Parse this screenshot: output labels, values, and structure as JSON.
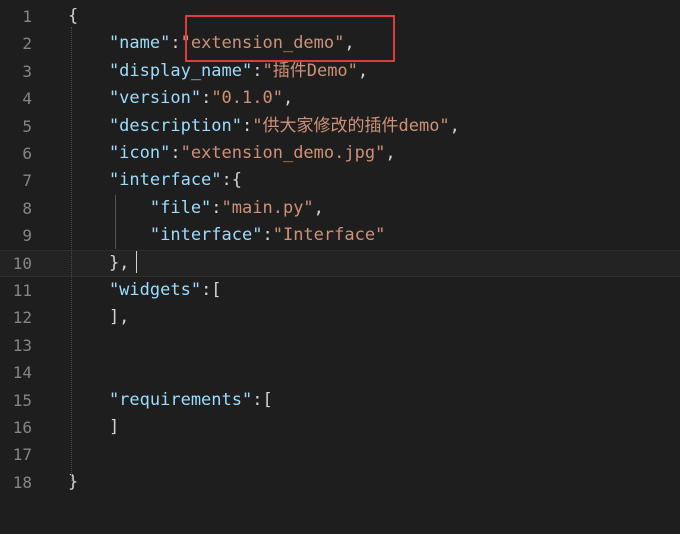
{
  "editor": {
    "line_numbers": [
      "1",
      "2",
      "3",
      "4",
      "5",
      "6",
      "7",
      "8",
      "9",
      "10",
      "11",
      "12",
      "13",
      "14",
      "15",
      "16",
      "17",
      "18"
    ],
    "lines": [
      [
        {
          "t": "{",
          "c": "punc"
        }
      ],
      [
        {
          "t": "    \"name\"",
          "c": "key"
        },
        {
          "t": ":",
          "c": "punc"
        },
        {
          "t": "\"extension_demo\"",
          "c": "str"
        },
        {
          "t": ",",
          "c": "punc"
        }
      ],
      [
        {
          "t": "    \"display_name\"",
          "c": "key"
        },
        {
          "t": ":",
          "c": "punc"
        },
        {
          "t": "\"插件Demo\"",
          "c": "str"
        },
        {
          "t": ",",
          "c": "punc"
        }
      ],
      [
        {
          "t": "    \"version\"",
          "c": "key"
        },
        {
          "t": ":",
          "c": "punc"
        },
        {
          "t": "\"0.1.0\"",
          "c": "str"
        },
        {
          "t": ",",
          "c": "punc"
        }
      ],
      [
        {
          "t": "    \"description\"",
          "c": "key"
        },
        {
          "t": ":",
          "c": "punc"
        },
        {
          "t": "\"供大家修改的插件demo\"",
          "c": "str"
        },
        {
          "t": ",",
          "c": "punc"
        }
      ],
      [
        {
          "t": "    \"icon\"",
          "c": "key"
        },
        {
          "t": ":",
          "c": "punc"
        },
        {
          "t": "\"extension_demo.jpg\"",
          "c": "str"
        },
        {
          "t": ",",
          "c": "punc"
        }
      ],
      [
        {
          "t": "    \"interface\"",
          "c": "key"
        },
        {
          "t": ":{",
          "c": "punc"
        }
      ],
      [
        {
          "t": "        \"file\"",
          "c": "key"
        },
        {
          "t": ":",
          "c": "punc"
        },
        {
          "t": "\"main.py\"",
          "c": "str"
        },
        {
          "t": ",",
          "c": "punc"
        }
      ],
      [
        {
          "t": "        \"interface\"",
          "c": "key"
        },
        {
          "t": ":",
          "c": "punc"
        },
        {
          "t": "\"Interface\"",
          "c": "str"
        }
      ],
      [
        {
          "t": "    },",
          "c": "punc"
        }
      ],
      [
        {
          "t": "    \"widgets\"",
          "c": "key"
        },
        {
          "t": ":[",
          "c": "punc"
        }
      ],
      [
        {
          "t": "    ],",
          "c": "punc"
        }
      ],
      [],
      [],
      [
        {
          "t": "    \"requirements\"",
          "c": "key"
        },
        {
          "t": ":[",
          "c": "punc"
        }
      ],
      [
        {
          "t": "    ]",
          "c": "punc"
        }
      ],
      [],
      [
        {
          "t": "}",
          "c": "punc"
        }
      ]
    ],
    "current_line": 10
  },
  "colors": {
    "background": "#1e1e1e",
    "string": "#ce9178",
    "key": "#9cdcfe",
    "line_number": "#858585",
    "highlight_box": "#e0393e"
  }
}
